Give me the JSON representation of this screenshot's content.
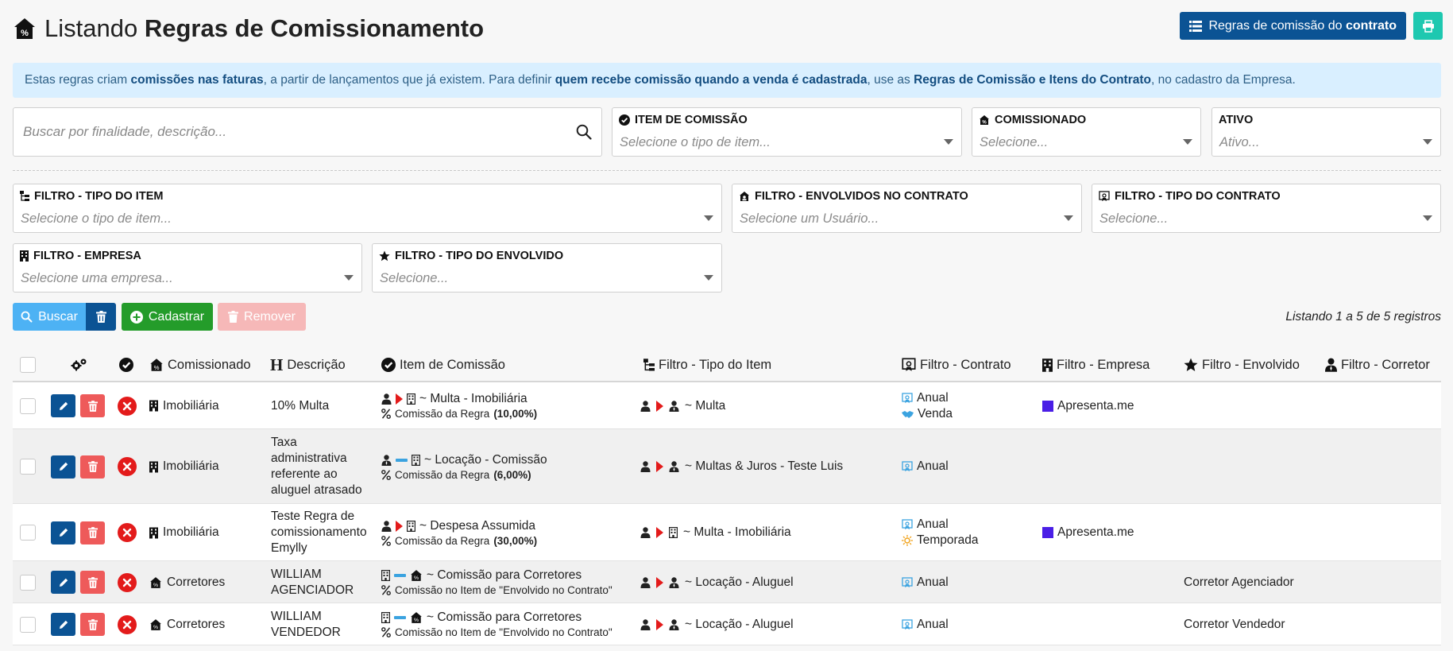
{
  "header": {
    "title_prefix": "Listando",
    "title_main": "Regras de Comissionamento",
    "contract_rules_prefix": "Regras de comissão do",
    "contract_rules_bold": "contrato"
  },
  "info": {
    "t1": "Estas regras criam ",
    "b1": "comissões nas faturas",
    "t2": ", a partir de lançamentos que já existem. Para definir ",
    "b2": "quem recebe comissão quando a venda é cadastrada",
    "t3": ", use as ",
    "b3": "Regras de Comissão e Itens do Contrato",
    "t4": ", no cadastro da Empresa."
  },
  "filters": {
    "search_placeholder": "Buscar por finalidade, descrição...",
    "item_label": "ITEM DE COMISSÃO",
    "item_placeholder": "Selecione o tipo de item...",
    "commissioned_label": "COMISSIONADO",
    "commissioned_placeholder": "Selecione...",
    "active_label": "ATIVO",
    "active_placeholder": "Ativo...",
    "item_type_label": "FILTRO - TIPO DO ITEM",
    "item_type_placeholder": "Selecione o tipo de item...",
    "involved_label": "FILTRO - ENVOLVIDOS NO CONTRATO",
    "involved_placeholder": "Selecione um Usuário...",
    "contract_type_label": "FILTRO - TIPO DO CONTRATO",
    "contract_type_placeholder": "Selecione...",
    "company_label": "FILTRO - EMPRESA",
    "company_placeholder": "Selecione uma empresa...",
    "involved_type_label": "FILTRO - TIPO DO ENVOLVIDO",
    "involved_type_placeholder": "Selecione..."
  },
  "actions": {
    "search": "Buscar",
    "new": "Cadastrar",
    "remove": "Remover",
    "count": "Listando 1 a 5 de 5 registros"
  },
  "table": {
    "headers": {
      "commissioned": "Comissionado",
      "description": "Descrição",
      "item": "Item de Comissão",
      "item_type": "Filtro - Tipo do Item",
      "contract": "Filtro - Contrato",
      "company": "Filtro - Empresa",
      "involved": "Filtro - Envolvido",
      "broker": "Filtro - Corretor"
    },
    "rows": [
      {
        "commissioned": "Imobiliária",
        "description": [
          "10% Multa"
        ],
        "item_line": "~ Multa - Imobiliária",
        "rule_prefix": "Comissão da Regra ",
        "rule_value": "(10,00%)",
        "item_type": "~ Multa",
        "contract": [
          "Anual",
          "Venda"
        ],
        "company": "Apresenta.me",
        "involved": ""
      },
      {
        "commissioned": "Imobiliária",
        "description": [
          "Taxa",
          "administrativa",
          "referente ao",
          "aluguel atrasado"
        ],
        "item_line": "~ Locação - Comissão",
        "rule_prefix": "Comissão da Regra ",
        "rule_value": "(6,00%)",
        "item_type": "~ Multas & Juros - Teste Luis",
        "contract": [
          "Anual"
        ],
        "company": "",
        "involved": ""
      },
      {
        "commissioned": "Imobiliária",
        "description": [
          "Teste Regra de",
          "comissionamento",
          "Emylly"
        ],
        "item_line": "~ Despesa Assumida",
        "rule_prefix": "Comissão da Regra ",
        "rule_value": "(30,00%)",
        "item_type": "~ Multa - Imobiliária",
        "contract": [
          "Anual",
          "Temporada"
        ],
        "company": "Apresenta.me",
        "involved": ""
      },
      {
        "commissioned": "Corretores",
        "description": [
          "WILLIAM",
          "AGENCIADOR"
        ],
        "item_line": "~ Comissão para Corretores",
        "rule_prefix": "Comissão no Item de \"Envolvido no Contrato\"",
        "rule_value": "",
        "item_type": "~ Locação - Aluguel",
        "contract": [
          "Anual"
        ],
        "company": "",
        "involved": "Corretor Agenciador"
      },
      {
        "commissioned": "Corretores",
        "description": [
          "WILLIAM",
          "VENDEDOR"
        ],
        "item_line": "~ Comissão para Corretores",
        "rule_prefix": "Comissão no Item de \"Envolvido no Contrato\"",
        "rule_value": "",
        "item_type": "~ Locação - Aluguel",
        "contract": [
          "Anual"
        ],
        "company": "",
        "involved": "Corretor Vendedor"
      }
    ]
  },
  "colors": {
    "primary": "#0b5394",
    "info_bg": "#d9efff",
    "teal": "#1ec8b0",
    "green": "#249c2a",
    "light_blue": "#4db2f4",
    "red": "#e31b1b",
    "company_square": "#4a1ee6"
  }
}
